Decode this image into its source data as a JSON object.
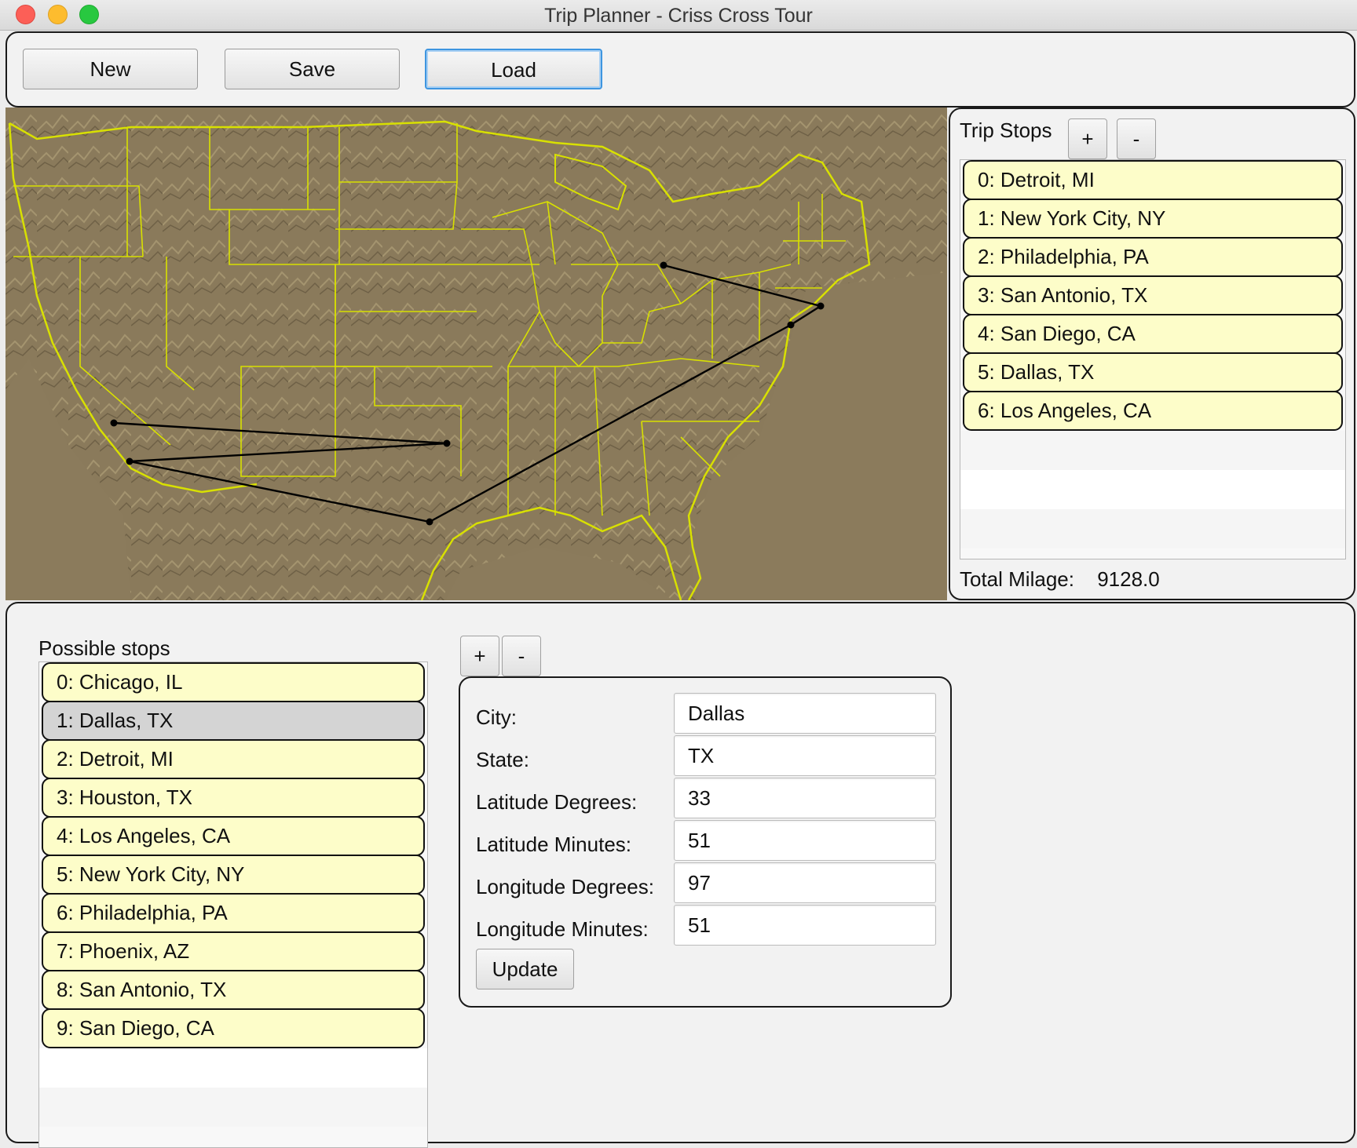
{
  "window": {
    "title": "Trip Planner - Criss Cross Tour"
  },
  "toolbar": {
    "new_label": "New",
    "save_label": "Save",
    "load_label": "Load"
  },
  "trip": {
    "title": "Trip Stops",
    "add_label": "+",
    "remove_label": "-",
    "stops": [
      "0: Detroit, MI",
      "1: New York City, NY",
      "2: Philadelphia, PA",
      "3: San Antonio, TX",
      "4: San Diego, CA",
      "5: Dallas, TX",
      "6: Los Angeles, CA"
    ],
    "total_label": "Total Milage:",
    "total_value": "9128.0"
  },
  "possible": {
    "title": "Possible stops",
    "selected_index": 1,
    "items": [
      "0: Chicago, IL",
      "1: Dallas, TX",
      "2: Detroit, MI",
      "3: Houston, TX",
      "4: Los Angeles, CA",
      "5: New York City, NY",
      "6: Philadelphia, PA",
      "7: Phoenix, AZ",
      "8: San Antonio, TX",
      "9: San Diego, CA"
    ]
  },
  "editor": {
    "add_label": "+",
    "remove_label": "-",
    "city_label": "City:",
    "city_value": "Dallas",
    "state_label": "State:",
    "state_value": "TX",
    "lat_deg_label": "Latitude Degrees:",
    "lat_deg_value": "33",
    "lat_min_label": "Latitude Minutes:",
    "lat_min_value": "51",
    "lon_deg_label": "Longitude Degrees:",
    "lon_deg_value": "97",
    "lon_min_label": "Longitude Minutes:",
    "lon_min_value": "51",
    "update_label": "Update"
  },
  "colors": {
    "map_land": "#8b7b5c",
    "state_border": "#d8e000",
    "route": "#000000",
    "list_item": "#fdfdc9",
    "list_selected": "#d4d4d4",
    "focus_ring": "#3e95e0"
  }
}
